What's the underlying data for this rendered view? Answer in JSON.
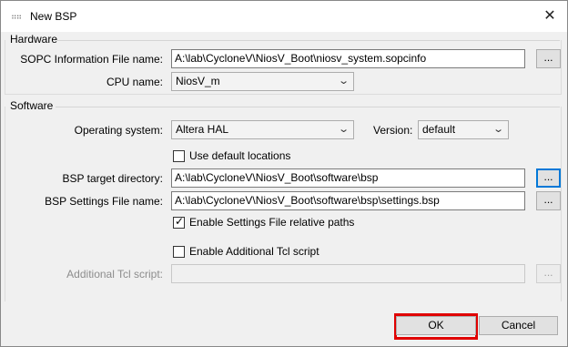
{
  "window": {
    "title": "New BSP",
    "close_glyph": "✕",
    "icon": "nios-icon"
  },
  "hardware": {
    "group_label": "Hardware",
    "sopc_label": "SOPC Information File name:",
    "sopc_value": "A:\\lab\\CycloneV\\NiosV_Boot\\niosv_system.sopcinfo",
    "browse_label": "...",
    "cpu_label": "CPU name:",
    "cpu_value": "NiosV_m"
  },
  "software": {
    "group_label": "Software",
    "os_label": "Operating system:",
    "os_value": "Altera HAL",
    "version_label": "Version:",
    "version_value": "default",
    "use_default_label": "Use default locations",
    "use_default_checked": false,
    "bsp_dir_label": "BSP target directory:",
    "bsp_dir_value": "A:\\lab\\CycloneV\\NiosV_Boot\\software\\bsp",
    "bsp_settings_label": "BSP Settings File name:",
    "bsp_settings_value": "A:\\lab\\CycloneV\\NiosV_Boot\\software\\bsp\\settings.bsp",
    "relative_paths_label": "Enable Settings File relative paths",
    "relative_paths_checked": true,
    "additional_tcl_label": "Enable Additional Tcl script",
    "additional_tcl_checked": false,
    "tcl_script_label": "Additional Tcl script:",
    "tcl_script_value": "",
    "browse_label": "..."
  },
  "buttons": {
    "ok_label": "OK",
    "cancel_label": "Cancel"
  },
  "colors": {
    "highlight": "#e00000",
    "focus": "#0078d7"
  }
}
